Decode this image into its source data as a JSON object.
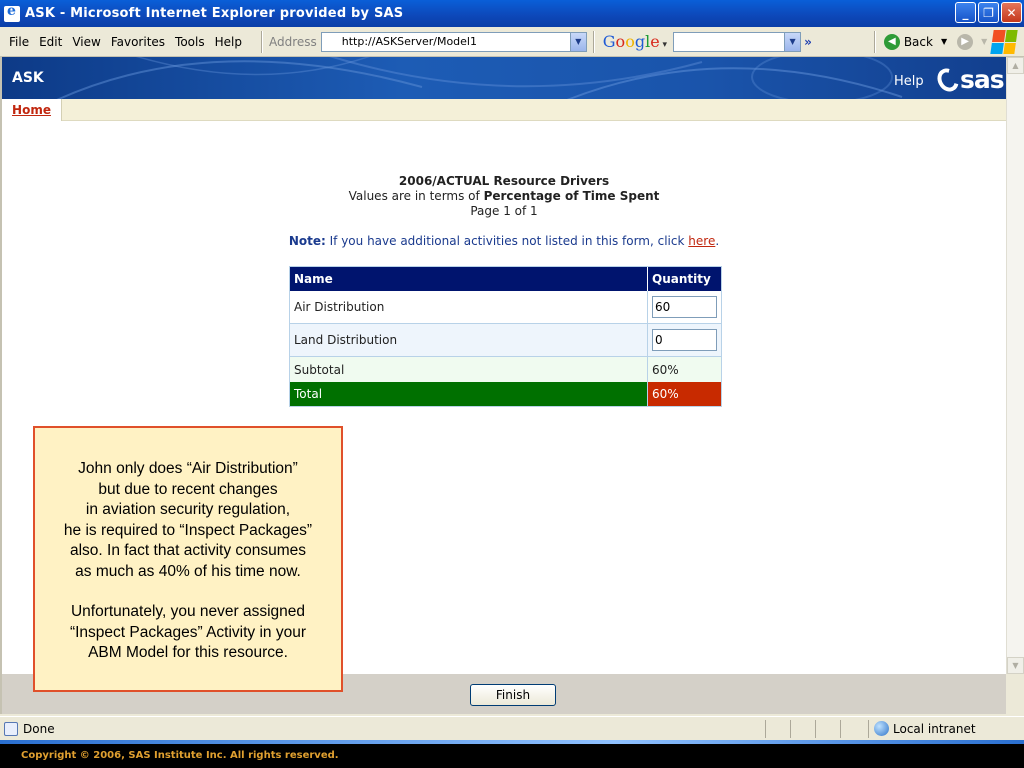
{
  "window": {
    "title": "ASK - Microsoft Internet Explorer provided by SAS",
    "minimize": "_",
    "restore": "❐",
    "close": "✕"
  },
  "menu": [
    "File",
    "Edit",
    "View",
    "Favorites",
    "Tools",
    "Help"
  ],
  "address": {
    "label": "Address",
    "url": "http://ASKServer/Model1"
  },
  "toolbar": {
    "google_search_value": "",
    "more": "»",
    "back_label": "Back"
  },
  "app": {
    "name": "ASK",
    "help": "Help",
    "logo_text": "sas"
  },
  "tabs": {
    "home": "Home"
  },
  "report": {
    "title": "2006/ACTUAL Resource Drivers",
    "values_prefix": "Values are in terms of",
    "values_unit": "Percentage of Time Spent",
    "page": "Page 1 of 1",
    "note_label": "Note:",
    "note_text": "If you have additional activities not listed in this form, click",
    "note_link": "here",
    "note_end": "."
  },
  "table": {
    "headers": {
      "name": "Name",
      "quantity": "Quantity"
    },
    "rows": [
      {
        "name": "Air Distribution",
        "quantity": "60"
      },
      {
        "name": "Land Distribution",
        "quantity": "0"
      }
    ],
    "subtotal": {
      "label": "Subtotal",
      "value": "60%"
    },
    "total": {
      "label": "Total",
      "value": "60%"
    }
  },
  "actions": {
    "finish": "Finish"
  },
  "status": {
    "text": "Done",
    "zone": "Local intranet"
  },
  "footer": {
    "copyright": "Copyright © 2006, SAS Institute Inc. All rights reserved."
  },
  "callout": {
    "lines1": [
      "John only does “Air Distribution”",
      "but due to recent changes",
      "in aviation security regulation,",
      "he is required to “Inspect Packages”",
      "also. In fact that activity consumes",
      "as much as 40% of his time now."
    ],
    "lines2": [
      "Unfortunately, you never assigned",
      "“Inspect Packages” Activity in your",
      "ABM Model for this resource."
    ]
  },
  "colors": {
    "header_blue": "#1d5cb5",
    "table_header": "#00146e",
    "total_green": "#007000",
    "total_red": "#c82a00",
    "callout_border": "#e0502a",
    "callout_fill": "#fff2c4"
  }
}
